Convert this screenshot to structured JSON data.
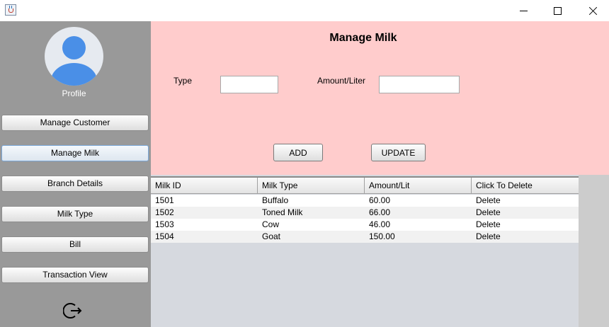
{
  "window": {
    "icons": {
      "app": "java-coffee-cup-icon",
      "minimize": "minimize-icon",
      "maximize": "maximize-icon",
      "close": "close-icon"
    }
  },
  "sidebar": {
    "profile_label": "Profile",
    "avatar_icon": "user-avatar-icon",
    "items": [
      {
        "label": "Manage Customer",
        "active": false
      },
      {
        "label": "Manage Milk",
        "active": true
      },
      {
        "label": "Branch Details",
        "active": false
      },
      {
        "label": "Milk Type",
        "active": false
      },
      {
        "label": "Bill",
        "active": false
      },
      {
        "label": "Transaction View",
        "active": false
      }
    ],
    "logout_icon": "logout-icon"
  },
  "form": {
    "title": "Manage Milk",
    "type_label": "Type",
    "type_value": "",
    "amount_label": "Amount/Liter",
    "amount_value": "",
    "add_label": "ADD",
    "update_label": "UPDATE"
  },
  "table": {
    "columns": [
      "Milk ID",
      "Milk Type",
      "Amount/Lit",
      "Click To Delete"
    ],
    "rows": [
      [
        "1501",
        "Buffalo",
        "60.00",
        "Delete"
      ],
      [
        "1502",
        "Toned Milk",
        "66.00",
        "Delete"
      ],
      [
        "1503",
        "Cow",
        "46.00",
        "Delete"
      ],
      [
        "1504",
        "Goat",
        "150.00",
        "Delete"
      ]
    ]
  },
  "colors": {
    "sidebar_bg": "#999999",
    "form_bg": "#ffcccc",
    "table_bg": "#d6d9df",
    "avatar_blue": "#4a8fe7"
  }
}
